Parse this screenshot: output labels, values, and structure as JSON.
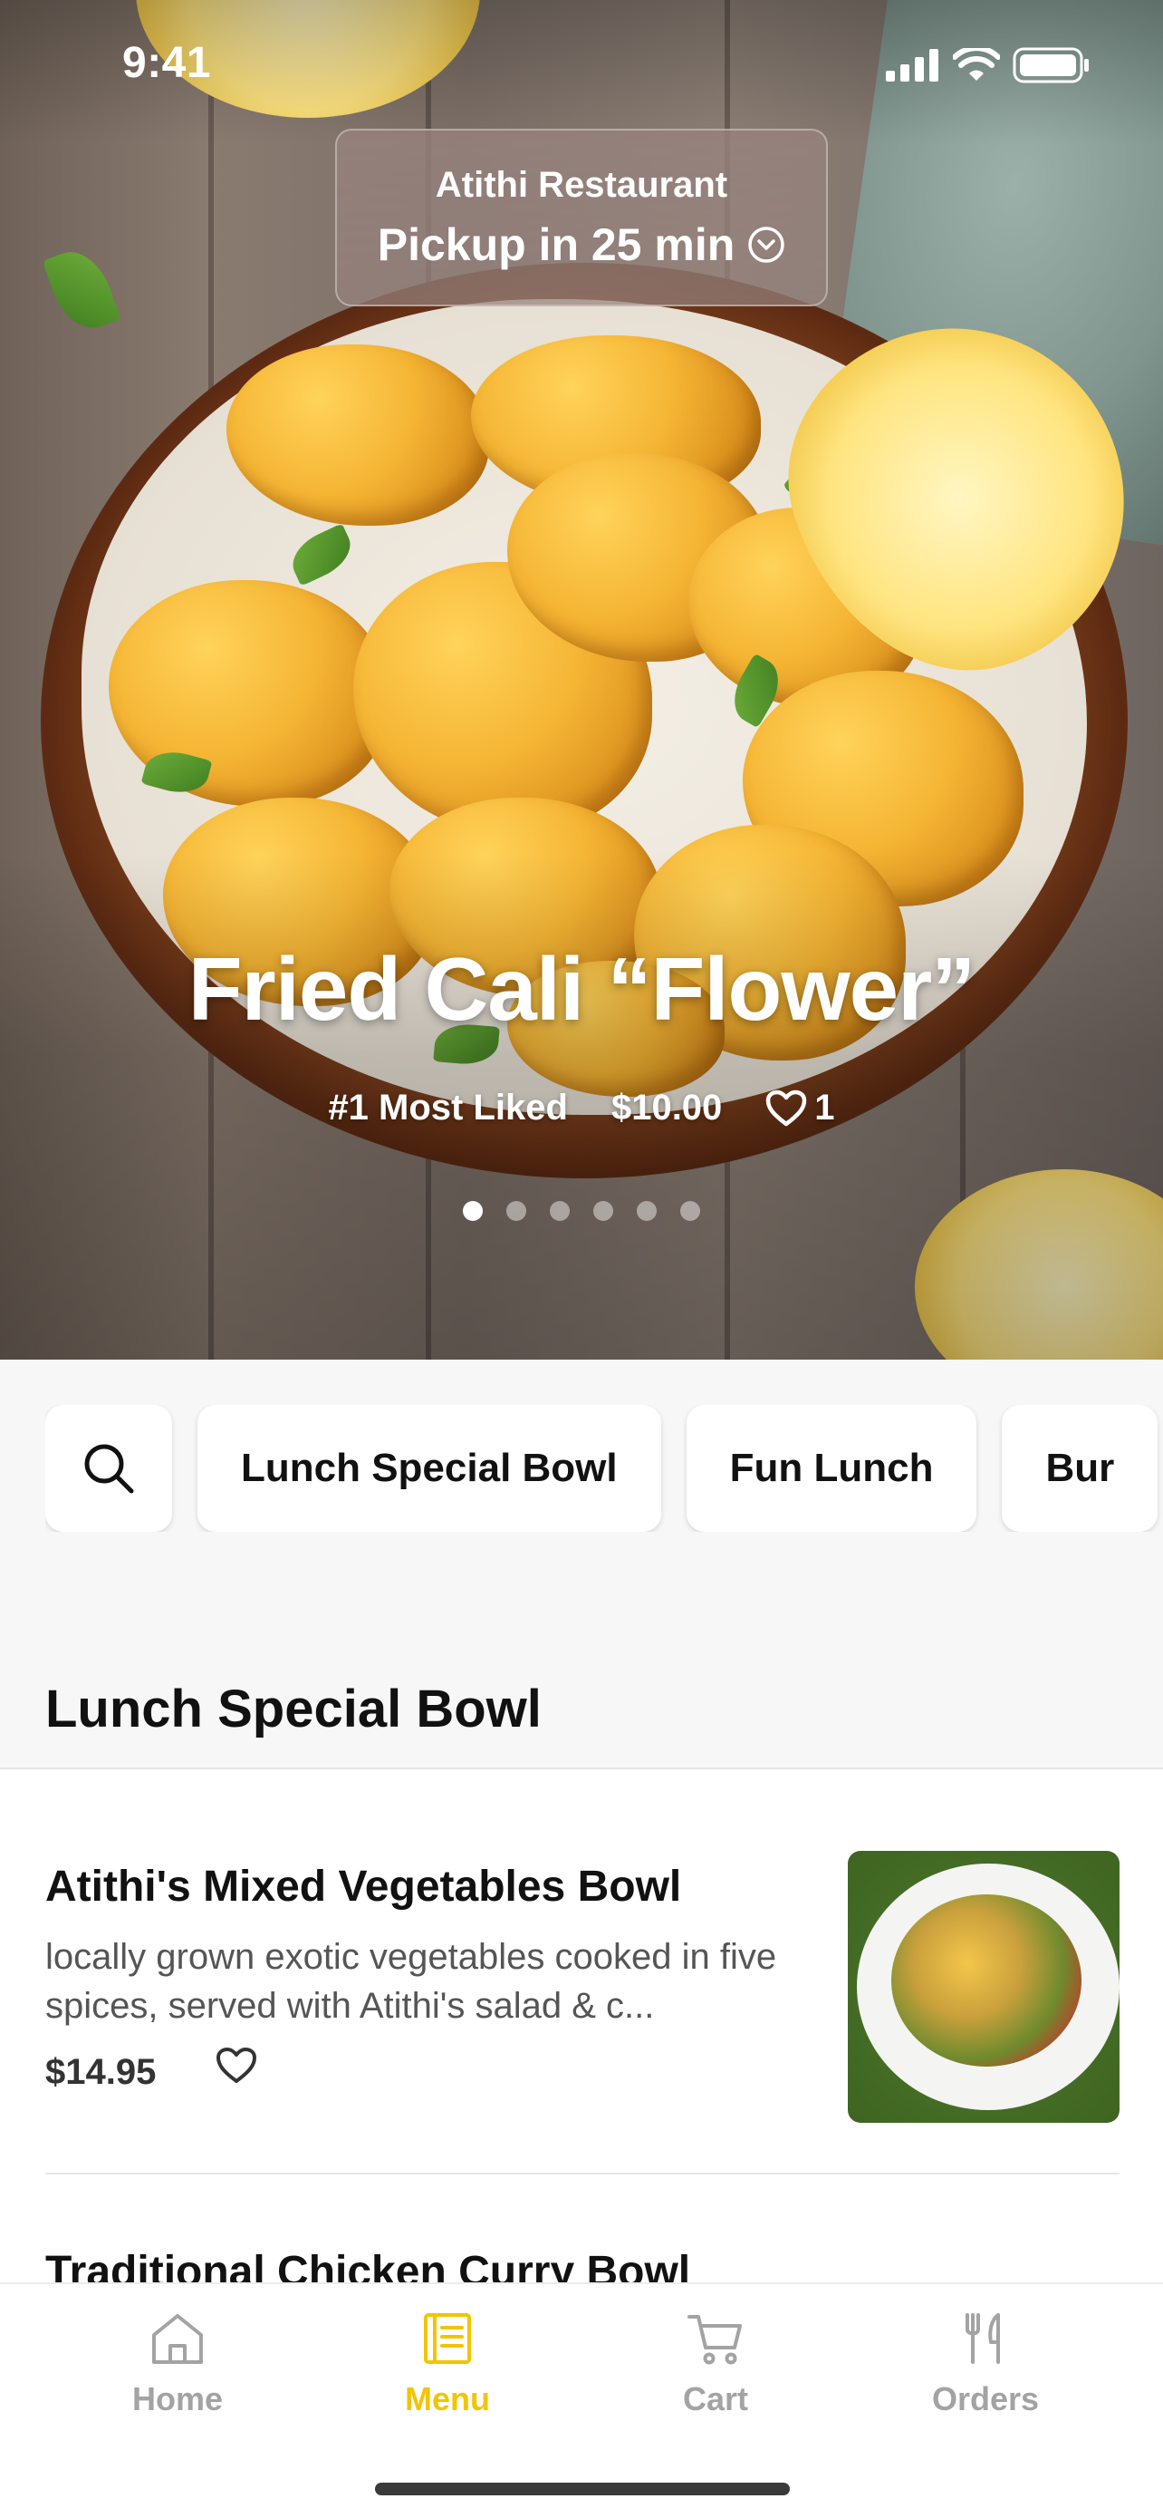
{
  "status_bar": {
    "time": "9:41"
  },
  "header": {
    "restaurant": "Atithi Restaurant",
    "pickup_eta": "Pickup in 25 min"
  },
  "hero": {
    "title": "Fried Cali “Flower”",
    "badge": "#1 Most Liked",
    "price": "$10.00",
    "likes": "1",
    "carousel": {
      "count": 6,
      "active_index": 0
    }
  },
  "categories": [
    "Lunch Special Bowl",
    "Fun Lunch",
    "Bur"
  ],
  "section": {
    "title": "Lunch Special Bowl"
  },
  "items": [
    {
      "name": "Atithi's Mixed Vegetables Bowl",
      "description": "locally grown exotic vegetables cooked in five spices, served with Atithi's salad & c...",
      "price": "$14.95"
    },
    {
      "name": "Traditional Chicken Curry  Bowl"
    }
  ],
  "tabs": [
    {
      "label": "Home",
      "icon": "home-icon",
      "active": false
    },
    {
      "label": "Menu",
      "icon": "menu-book-icon",
      "active": true
    },
    {
      "label": "Cart",
      "icon": "cart-icon",
      "active": false
    },
    {
      "label": "Orders",
      "icon": "fork-knife-icon",
      "active": false
    }
  ],
  "colors": {
    "accent": "#F2C500",
    "inactive_tab": "#A3A3A3",
    "text": "#111111"
  }
}
